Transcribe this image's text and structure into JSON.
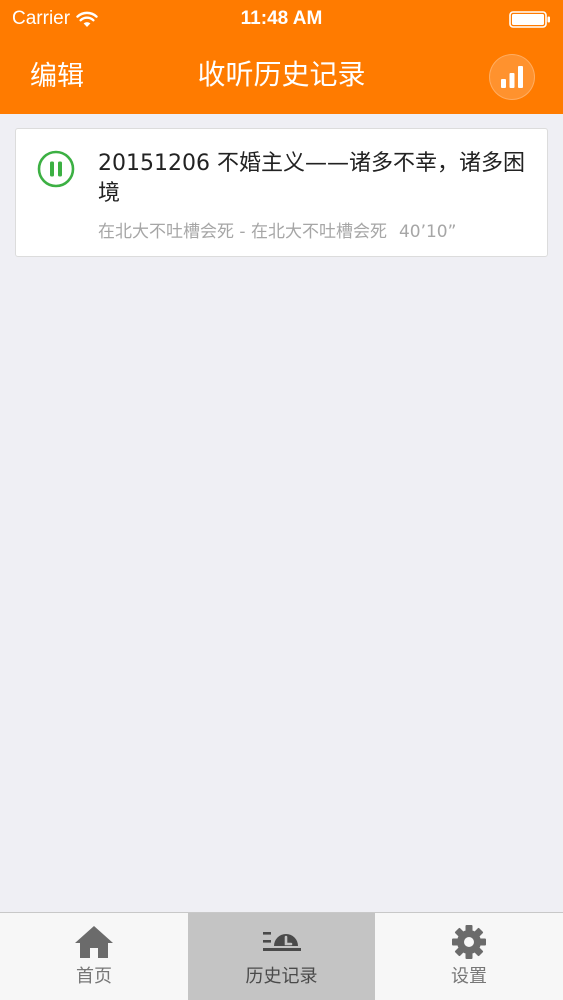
{
  "statusbar": {
    "carrier": "Carrier",
    "time": "11:48 AM"
  },
  "navbar": {
    "edit_label": "编辑",
    "title": "收听历史记录",
    "now_playing_icon": "bars-chart-icon"
  },
  "history": {
    "items": [
      {
        "title": "20151206 不婚主义——诸多不幸，诸多困境",
        "meta": "在北大不吐槽会死 - 在北大不吐槽会死",
        "duration": "40’10”",
        "state_icon": "pause-icon"
      }
    ]
  },
  "tabbar": {
    "tabs": [
      {
        "label": "首页",
        "icon": "home-icon",
        "active": false
      },
      {
        "label": "历史记录",
        "icon": "history-icon",
        "active": true
      },
      {
        "label": "设置",
        "icon": "gear-icon",
        "active": false
      }
    ]
  },
  "colors": {
    "accent": "#ff7b00",
    "play_state": "#3cb043",
    "background": "#efeff4",
    "tab_active": "#c4c4c4"
  }
}
